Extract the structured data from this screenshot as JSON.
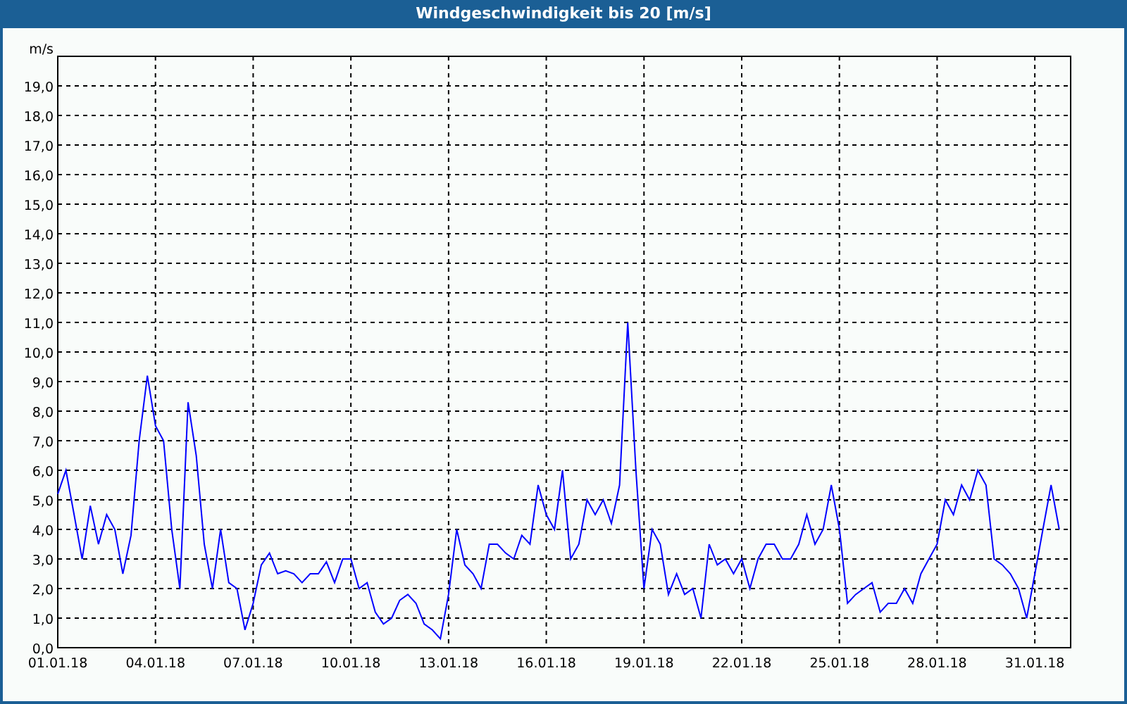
{
  "window": {
    "title": "Windgeschwindigkeit bis 20 [m/s]"
  },
  "chart": {
    "chart_data": {
      "type": "line",
      "ylabel": "m/s",
      "grid": true,
      "ylim": [
        0,
        20
      ],
      "yticks": [
        {
          "value": 0,
          "label": "0,0"
        },
        {
          "value": 1,
          "label": "1,0"
        },
        {
          "value": 2,
          "label": "2,0"
        },
        {
          "value": 3,
          "label": "3,0"
        },
        {
          "value": 4,
          "label": "4,0"
        },
        {
          "value": 5,
          "label": "5,0"
        },
        {
          "value": 6,
          "label": "6,0"
        },
        {
          "value": 7,
          "label": "7,0"
        },
        {
          "value": 8,
          "label": "8,0"
        },
        {
          "value": 9,
          "label": "9,0"
        },
        {
          "value": 10,
          "label": "10,0"
        },
        {
          "value": 11,
          "label": "11,0"
        },
        {
          "value": 12,
          "label": "12,0"
        },
        {
          "value": 13,
          "label": "13,0"
        },
        {
          "value": 14,
          "label": "14,0"
        },
        {
          "value": 15,
          "label": "15,0"
        },
        {
          "value": 16,
          "label": "16,0"
        },
        {
          "value": 17,
          "label": "17,0"
        },
        {
          "value": 18,
          "label": "18,0"
        },
        {
          "value": 19,
          "label": "19,0"
        }
      ],
      "categories": [
        "01.01.18",
        null,
        null,
        null,
        null,
        null,
        null,
        null,
        null,
        null,
        null,
        null,
        "04.01.18",
        null,
        null,
        null,
        null,
        null,
        null,
        null,
        null,
        null,
        null,
        null,
        "07.01.18",
        null,
        null,
        null,
        null,
        null,
        null,
        null,
        null,
        null,
        null,
        null,
        "10.01.18",
        null,
        null,
        null,
        null,
        null,
        null,
        null,
        null,
        null,
        null,
        null,
        "13.01.18",
        null,
        null,
        null,
        null,
        null,
        null,
        null,
        null,
        null,
        null,
        null,
        "16.01.18",
        null,
        null,
        null,
        null,
        null,
        null,
        null,
        null,
        null,
        null,
        null,
        "19.01.18",
        null,
        null,
        null,
        null,
        null,
        null,
        null,
        null,
        null,
        null,
        null,
        "22.01.18",
        null,
        null,
        null,
        null,
        null,
        null,
        null,
        null,
        null,
        null,
        null,
        "25.01.18",
        null,
        null,
        null,
        null,
        null,
        null,
        null,
        null,
        null,
        null,
        null,
        "28.01.18",
        null,
        null,
        null,
        null,
        null,
        null,
        null,
        null,
        null,
        null,
        null,
        "31.01.18",
        null,
        null,
        null
      ],
      "series": [
        {
          "color": "#0000ff",
          "values": [
            5.2,
            6.0,
            4.5,
            3.0,
            4.8,
            3.5,
            4.5,
            4.0,
            2.5,
            3.8,
            7.0,
            9.2,
            7.5,
            7.0,
            4.0,
            2.0,
            8.3,
            6.5,
            3.5,
            2.0,
            4.0,
            2.2,
            2.0,
            0.6,
            1.5,
            2.8,
            3.2,
            2.5,
            2.6,
            2.5,
            2.2,
            2.5,
            2.5,
            2.9,
            2.2,
            3.0,
            3.0,
            2.0,
            2.2,
            1.2,
            0.8,
            1.0,
            1.6,
            1.8,
            1.5,
            0.8,
            0.6,
            0.3,
            1.8,
            4.0,
            2.8,
            2.5,
            2.0,
            3.5,
            3.5,
            3.2,
            3.0,
            3.8,
            3.5,
            5.5,
            4.5,
            4.0,
            6.0,
            3.0,
            3.5,
            5.0,
            4.5,
            5.0,
            4.2,
            5.5,
            11.0,
            6.0,
            2.0,
            4.0,
            3.5,
            1.8,
            2.5,
            1.8,
            2.0,
            1.0,
            3.5,
            2.8,
            3.0,
            2.5,
            3.0,
            2.0,
            3.0,
            3.5,
            3.5,
            3.0,
            3.0,
            3.5,
            4.5,
            3.5,
            4.0,
            5.5,
            4.0,
            1.5,
            1.8,
            2.0,
            2.2,
            1.2,
            1.5,
            1.5,
            2.0,
            1.5,
            2.5,
            3.0,
            3.5,
            5.0,
            4.5,
            5.5,
            5.0,
            6.0,
            5.5,
            3.0,
            2.8,
            2.5,
            2.0,
            1.0,
            2.5,
            4.0,
            5.5,
            4.0
          ]
        }
      ]
    }
  }
}
